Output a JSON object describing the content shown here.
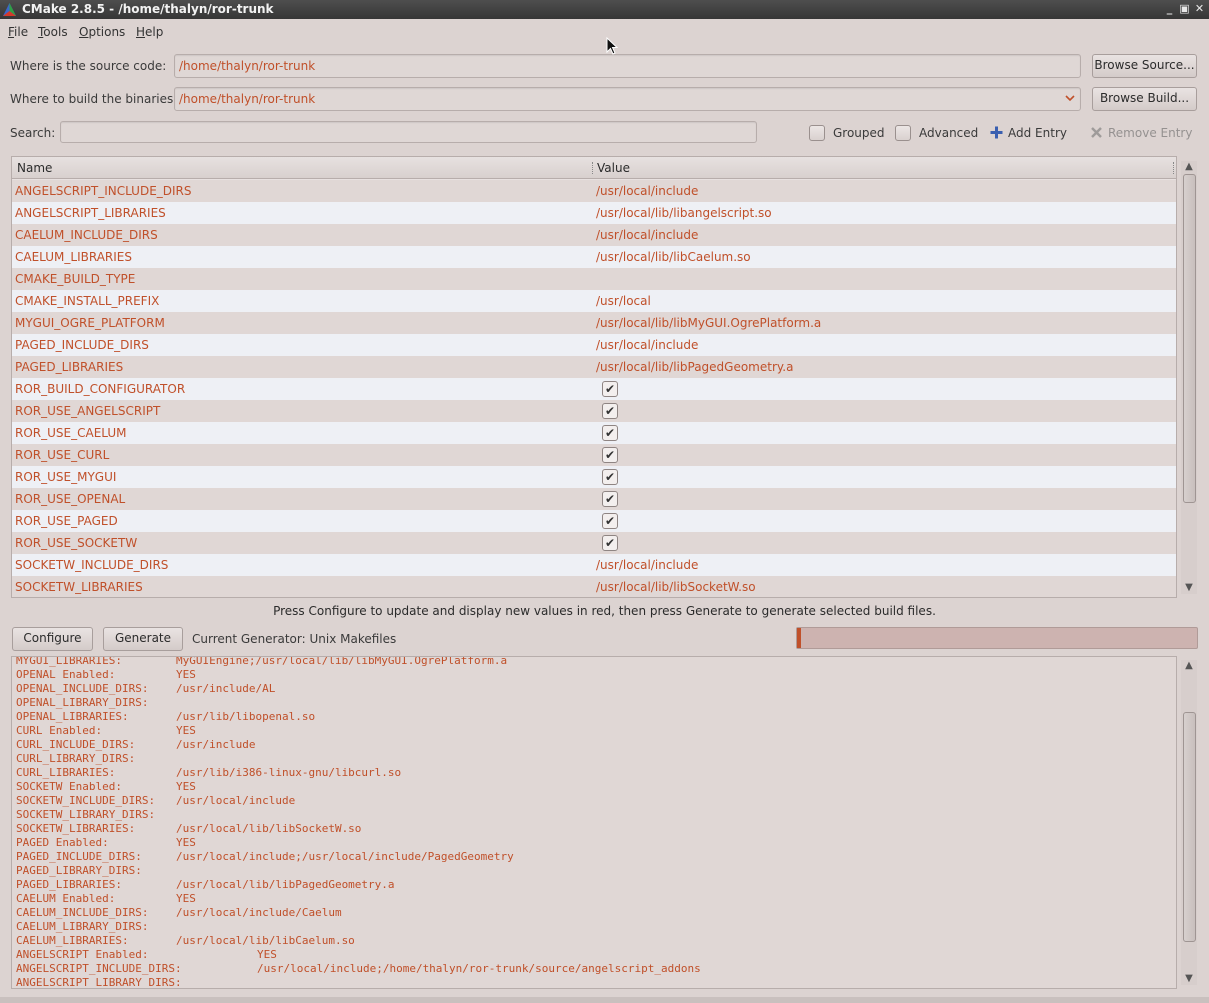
{
  "window": {
    "title": "CMake 2.8.5 - /home/thalyn/ror-trunk",
    "controls": [
      "_",
      "▣",
      "✕"
    ]
  },
  "menu": [
    {
      "label": "File",
      "mnemonic": "F",
      "rest": "ile"
    },
    {
      "label": "Tools",
      "mnemonic": "T",
      "rest": "ools"
    },
    {
      "label": "Options",
      "mnemonic": "O",
      "rest": "ptions"
    },
    {
      "label": "Help",
      "mnemonic": "H",
      "rest": "elp"
    }
  ],
  "source": {
    "label": "Where is the source code:",
    "value": "/home/thalyn/ror-trunk",
    "browse_label": "Browse Source..."
  },
  "build": {
    "label": "Where to build the binaries:",
    "value": "/home/thalyn/ror-trunk",
    "browse_label": "Browse Build..."
  },
  "search": {
    "label": "Search:",
    "value": "",
    "grouped_label": "Grouped",
    "advanced_label": "Advanced",
    "add_entry_label": "Add Entry",
    "remove_entry_label": "Remove Entry"
  },
  "table": {
    "columns": [
      "Name",
      "Value"
    ],
    "rows": [
      {
        "name": "ANGELSCRIPT_INCLUDE_DIRS",
        "value": "/usr/local/include",
        "type": "text"
      },
      {
        "name": "ANGELSCRIPT_LIBRARIES",
        "value": "/usr/local/lib/libangelscript.so",
        "type": "text"
      },
      {
        "name": "CAELUM_INCLUDE_DIRS",
        "value": "/usr/local/include",
        "type": "text"
      },
      {
        "name": "CAELUM_LIBRARIES",
        "value": "/usr/local/lib/libCaelum.so",
        "type": "text"
      },
      {
        "name": "CMAKE_BUILD_TYPE",
        "value": "",
        "type": "text"
      },
      {
        "name": "CMAKE_INSTALL_PREFIX",
        "value": "/usr/local",
        "type": "text"
      },
      {
        "name": "MYGUI_OGRE_PLATFORM",
        "value": "/usr/local/lib/libMyGUI.OgrePlatform.a",
        "type": "text"
      },
      {
        "name": "PAGED_INCLUDE_DIRS",
        "value": "/usr/local/include",
        "type": "text"
      },
      {
        "name": "PAGED_LIBRARIES",
        "value": "/usr/local/lib/libPagedGeometry.a",
        "type": "text"
      },
      {
        "name": "ROR_BUILD_CONFIGURATOR",
        "value": "✔",
        "type": "bool"
      },
      {
        "name": "ROR_USE_ANGELSCRIPT",
        "value": "✔",
        "type": "bool"
      },
      {
        "name": "ROR_USE_CAELUM",
        "value": "✔",
        "type": "bool"
      },
      {
        "name": "ROR_USE_CURL",
        "value": "✔",
        "type": "bool"
      },
      {
        "name": "ROR_USE_MYGUI",
        "value": "✔",
        "type": "bool"
      },
      {
        "name": "ROR_USE_OPENAL",
        "value": "✔",
        "type": "bool"
      },
      {
        "name": "ROR_USE_PAGED",
        "value": "✔",
        "type": "bool"
      },
      {
        "name": "ROR_USE_SOCKETW",
        "value": "✔",
        "type": "bool"
      },
      {
        "name": "SOCKETW_INCLUDE_DIRS",
        "value": "/usr/local/include",
        "type": "text"
      },
      {
        "name": "SOCKETW_LIBRARIES",
        "value": "/usr/local/lib/libSocketW.so",
        "type": "text"
      }
    ]
  },
  "hint": "Press Configure to update and display new values in red, then press Generate to generate selected build files.",
  "actions": {
    "configure_label": "Configure",
    "generate_label": "Generate",
    "generator_text": "Current Generator: Unix Makefiles",
    "progress": 0.01
  },
  "log": [
    {
      "k": "MYGUI_LIBRARIES:",
      "v": "MyGUIEngine;/usr/local/lib/libMyGUI.OgrePlatform.a",
      "wide": false
    },
    {
      "k": "OPENAL Enabled:",
      "v": "YES",
      "wide": false
    },
    {
      "k": "OPENAL_INCLUDE_DIRS:",
      "v": "/usr/include/AL",
      "wide": false
    },
    {
      "k": "OPENAL_LIBRARY_DIRS:",
      "v": "",
      "wide": false
    },
    {
      "k": "OPENAL_LIBRARIES:",
      "v": "/usr/lib/libopenal.so",
      "wide": false
    },
    {
      "k": "CURL Enabled:",
      "v": "YES",
      "wide": false
    },
    {
      "k": "CURL_INCLUDE_DIRS:",
      "v": "/usr/include",
      "wide": false
    },
    {
      "k": "CURL_LIBRARY_DIRS:",
      "v": "",
      "wide": false
    },
    {
      "k": "CURL_LIBRARIES:",
      "v": "/usr/lib/i386-linux-gnu/libcurl.so",
      "wide": false
    },
    {
      "k": "SOCKETW Enabled:",
      "v": "YES",
      "wide": false
    },
    {
      "k": "SOCKETW_INCLUDE_DIRS:",
      "v": "/usr/local/include",
      "wide": false
    },
    {
      "k": "SOCKETW_LIBRARY_DIRS:",
      "v": "",
      "wide": false
    },
    {
      "k": "SOCKETW_LIBRARIES:",
      "v": "/usr/local/lib/libSocketW.so",
      "wide": false
    },
    {
      "k": "PAGED Enabled:",
      "v": "YES",
      "wide": false
    },
    {
      "k": "PAGED_INCLUDE_DIRS:",
      "v": "/usr/local/include;/usr/local/include/PagedGeometry",
      "wide": false
    },
    {
      "k": "PAGED_LIBRARY_DIRS:",
      "v": "",
      "wide": false
    },
    {
      "k": "PAGED_LIBRARIES:",
      "v": "/usr/local/lib/libPagedGeometry.a",
      "wide": false
    },
    {
      "k": "CAELUM Enabled:",
      "v": "YES",
      "wide": false
    },
    {
      "k": "CAELUM_INCLUDE_DIRS:",
      "v": "/usr/local/include/Caelum",
      "wide": false
    },
    {
      "k": "CAELUM_LIBRARY_DIRS:",
      "v": "",
      "wide": false
    },
    {
      "k": "CAELUM_LIBRARIES:",
      "v": "/usr/local/lib/libCaelum.so",
      "wide": false
    },
    {
      "k": "ANGELSCRIPT Enabled:",
      "v": "YES",
      "wide": true
    },
    {
      "k": "ANGELSCRIPT_INCLUDE_DIRS:",
      "v": "/usr/local/include;/home/thalyn/ror-trunk/source/angelscript_addons",
      "wide": true
    },
    {
      "k": "ANGELSCRIPT_LIBRARY_DIRS:",
      "v": "",
      "wide": true
    }
  ],
  "icons": {
    "app": "cmake-triangle-icon",
    "add": "plus-icon",
    "remove": "x-icon",
    "combo": "chevron-down-icon"
  },
  "colors": {
    "accent": "#c0502a",
    "window_bg": "#dcd3d1",
    "row_odd": "#e0d7d5",
    "row_even": "#eef0f5"
  }
}
